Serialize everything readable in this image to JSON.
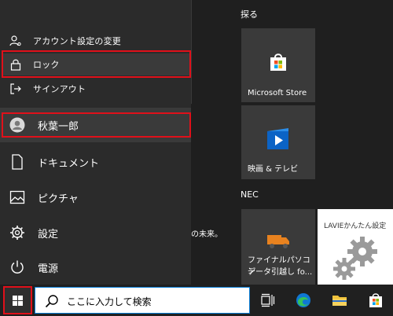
{
  "user_menu": {
    "change_account_settings": "アカウント設定の変更",
    "lock": "ロック",
    "sign_out": "サインアウト"
  },
  "user": {
    "name": "秋葉一郎"
  },
  "nav": {
    "documents": "ドキュメント",
    "pictures": "ピクチャ",
    "settings": "設定",
    "power": "電源"
  },
  "tiles": {
    "section_explore": "探る",
    "ms_store": "Microsoft Store",
    "movies_tv": "映画 & テレビ",
    "section_nec": "NEC",
    "transfer_line1": "ファイナルパソコン",
    "transfer_line2": "データ引越し fo...",
    "lavie_setup": "LAVIEかんたん設定"
  },
  "background": {
    "partial_text": "の未来。"
  },
  "taskbar": {
    "search_placeholder": "ここに入力して検索"
  },
  "colors": {
    "highlight": "#e0101a",
    "accent": "#0078d7"
  }
}
